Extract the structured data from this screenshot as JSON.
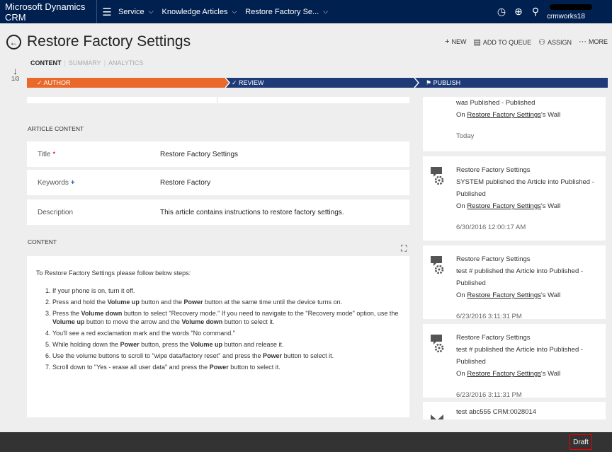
{
  "nav": {
    "brand": "Microsoft Dynamics CRM",
    "menu_icon": "hamburger-icon",
    "crumbs": [
      "Service",
      "Knowledge Articles",
      "Restore Factory Se..."
    ],
    "user_org": "crmworks18"
  },
  "header": {
    "title": "Restore Factory Settings",
    "commands": [
      {
        "icon": "plus-icon",
        "label": "NEW"
      },
      {
        "icon": "queue-icon",
        "label": "ADD TO QUEUE"
      },
      {
        "icon": "assign-icon",
        "label": "ASSIGN"
      },
      {
        "icon": "more-icon",
        "label": "MORE"
      }
    ],
    "tabs": [
      "CONTENT",
      "SUMMARY",
      "ANALYTICS"
    ],
    "pager": "1/3"
  },
  "stages": [
    "AUTHOR",
    "REVIEW",
    "PUBLISH"
  ],
  "article": {
    "section": "ARTICLE CONTENT",
    "title_label": "Title",
    "title_value": "Restore Factory Settings",
    "keywords_label": "Keywords",
    "keywords_value": "Restore Factory",
    "description_label": "Description",
    "description_value": "This article contains instructions to restore factory settings."
  },
  "content": {
    "section": "CONTENT",
    "intro": "To Restore Factory Settings please follow below steps:",
    "steps": [
      "If your phone is on, turn it off.",
      "Press and hold the |Volume up| button and the |Power| button at the same time until the device turns on.",
      "Press the |Volume down| button to select \"Recovery mode.\" If you need to navigate to the \"Recovery mode\" option, use the |Volume up| button to move the arrow and the |Volume down| button to select it.",
      "You'll see a red exclamation mark and the words \"No command.\"",
      "While holding down the |Power| button, press the |Volume up| button and release it.",
      "Use the volume buttons to scroll to \"wipe data/factory reset\" and press the |Power| button to select it.",
      "Scroll down to \"Yes - erase all user data\" and press the |Power| button to select it."
    ]
  },
  "wall": {
    "first": {
      "line1": "was Published - Published",
      "on": "On",
      "link": "Restore Factory Settings",
      "suffix": "'s Wall",
      "ts": "Today"
    },
    "posts": [
      {
        "title": "Restore Factory Settings",
        "text": "SYSTEM published the Article into Published - Published",
        "on": "On",
        "link": "Restore Factory Settings",
        "suffix": "'s Wall",
        "ts": "6/30/2016 12:00:17 AM"
      },
      {
        "title": "Restore Factory Settings",
        "text": "test # published the Article into Published - Published",
        "on": "On",
        "link": "Restore Factory Settings",
        "suffix": "'s Wall",
        "ts": "6/23/2016 3:11:31 PM"
      },
      {
        "title": "Restore Factory Settings",
        "text": "test # published the Article into Published - Published",
        "on": "On",
        "link": "Restore Factory Settings",
        "suffix": "'s Wall",
        "ts": "6/23/2016 3:11:31 PM"
      }
    ],
    "last": "test abc555 CRM:0028014"
  },
  "footer": {
    "status": "Draft"
  }
}
